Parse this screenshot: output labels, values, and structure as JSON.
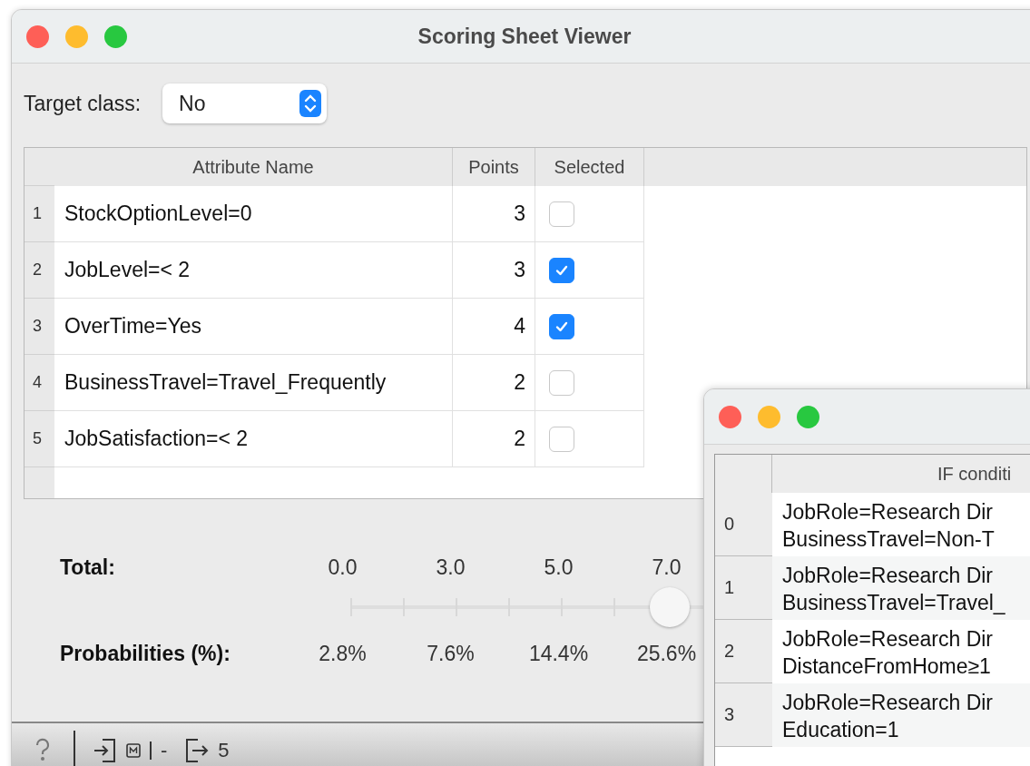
{
  "window": {
    "title": "Scoring Sheet Viewer"
  },
  "target_class": {
    "label": "Target class:",
    "value": "No"
  },
  "table": {
    "columns": [
      "Attribute Name",
      "Points",
      "Selected"
    ],
    "rows": [
      {
        "index": "1",
        "attribute": "StockOptionLevel=0",
        "points": "3",
        "selected": false
      },
      {
        "index": "2",
        "attribute": "JobLevel=< 2",
        "points": "3",
        "selected": true
      },
      {
        "index": "3",
        "attribute": "OverTime=Yes",
        "points": "4",
        "selected": true
      },
      {
        "index": "4",
        "attribute": "BusinessTravel=Travel_Frequently",
        "points": "2",
        "selected": false
      },
      {
        "index": "5",
        "attribute": "JobSatisfaction=< 2",
        "points": "2",
        "selected": false
      }
    ]
  },
  "total": {
    "label": "Total:",
    "ticks": [
      "0.0",
      "3.0",
      "5.0",
      "7.0"
    ],
    "level": 0.53
  },
  "probabilities": {
    "label": "Probabilities (%):",
    "values": [
      "2.8%",
      "7.6%",
      "14.4%",
      "25.6%"
    ]
  },
  "status_bar": {
    "input": "-",
    "output": "5"
  },
  "second_window": {
    "column": "IF conditi",
    "rows": [
      {
        "index": "0",
        "lines": [
          "JobRole=Research Dir",
          "BusinessTravel=Non-T"
        ]
      },
      {
        "index": "1",
        "lines": [
          "JobRole=Research Dir",
          "BusinessTravel=Travel_"
        ]
      },
      {
        "index": "2",
        "lines": [
          "JobRole=Research Dir",
          "DistanceFromHome≥1"
        ]
      },
      {
        "index": "3",
        "lines": [
          "JobRole=Research Dir",
          "Education=1"
        ]
      }
    ]
  }
}
